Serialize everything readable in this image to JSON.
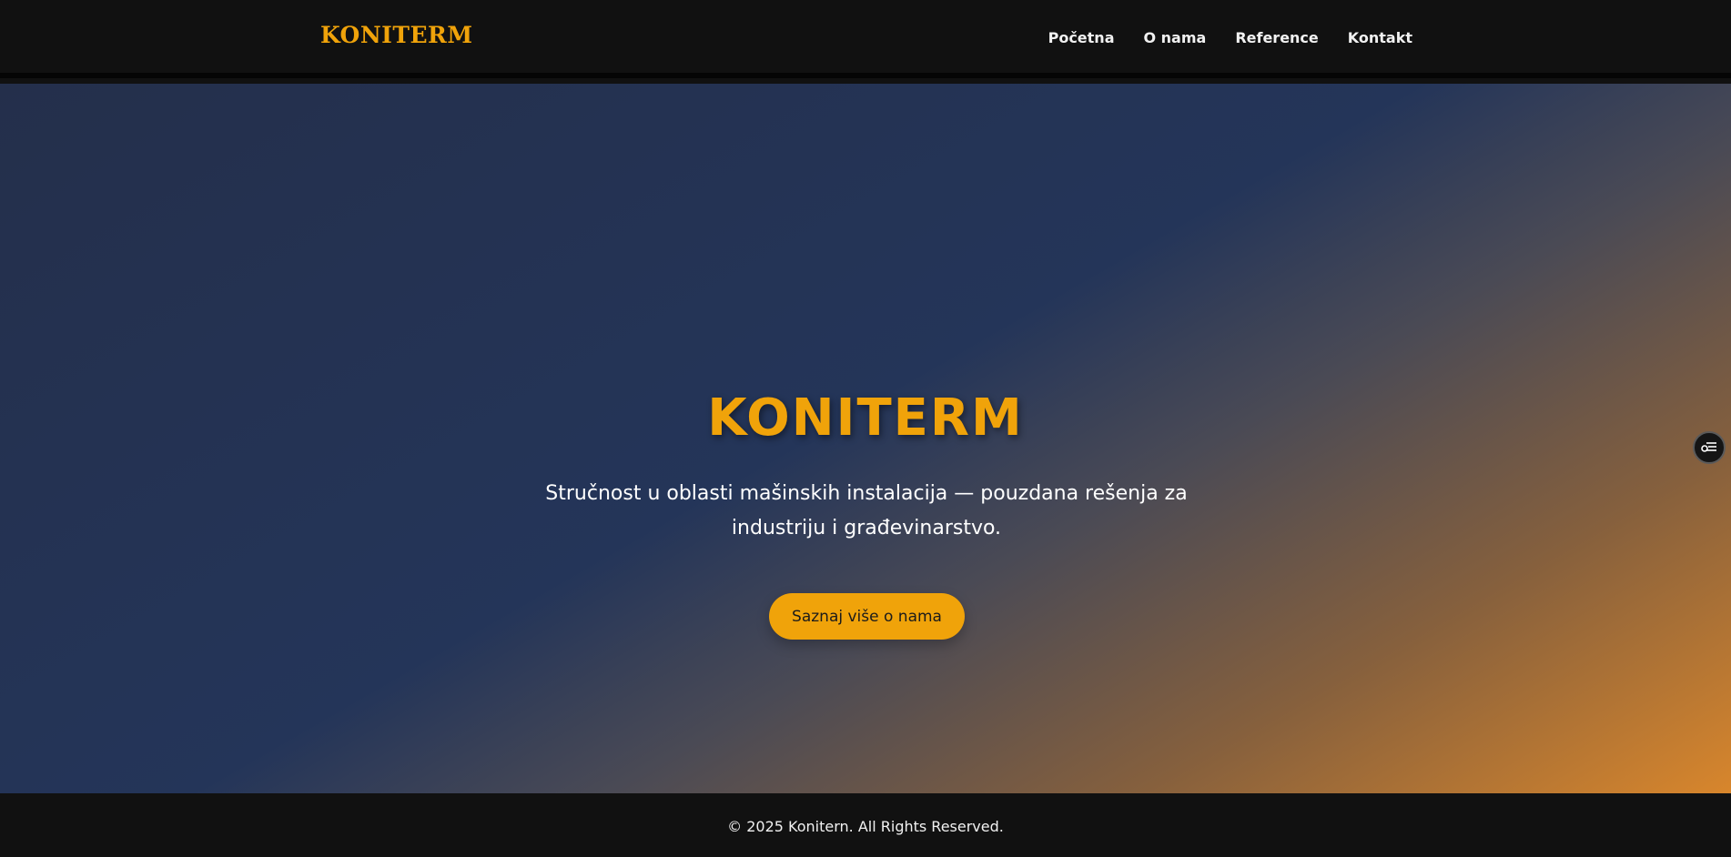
{
  "header": {
    "brand": "KONITERM",
    "nav": [
      {
        "label": "Početna"
      },
      {
        "label": "O nama"
      },
      {
        "label": "Reference"
      },
      {
        "label": "Kontakt"
      }
    ]
  },
  "hero": {
    "title": "KONITERM",
    "subtitle": "Stručnost u oblasti mašinskih instalacija — pouzdana rešenja za industriju i građevinarstvo.",
    "cta_label": "Saznaj više o nama"
  },
  "widget": {
    "icon": "settings-sliders-icon"
  },
  "footer": {
    "copyright": "© 2025 Konitern. All Rights Reserved."
  },
  "colors": {
    "accent": "#f0a30a",
    "background_dark": "#111111",
    "hero_gradient_start": "#242f4b",
    "hero_gradient_end": "#d8862c"
  }
}
